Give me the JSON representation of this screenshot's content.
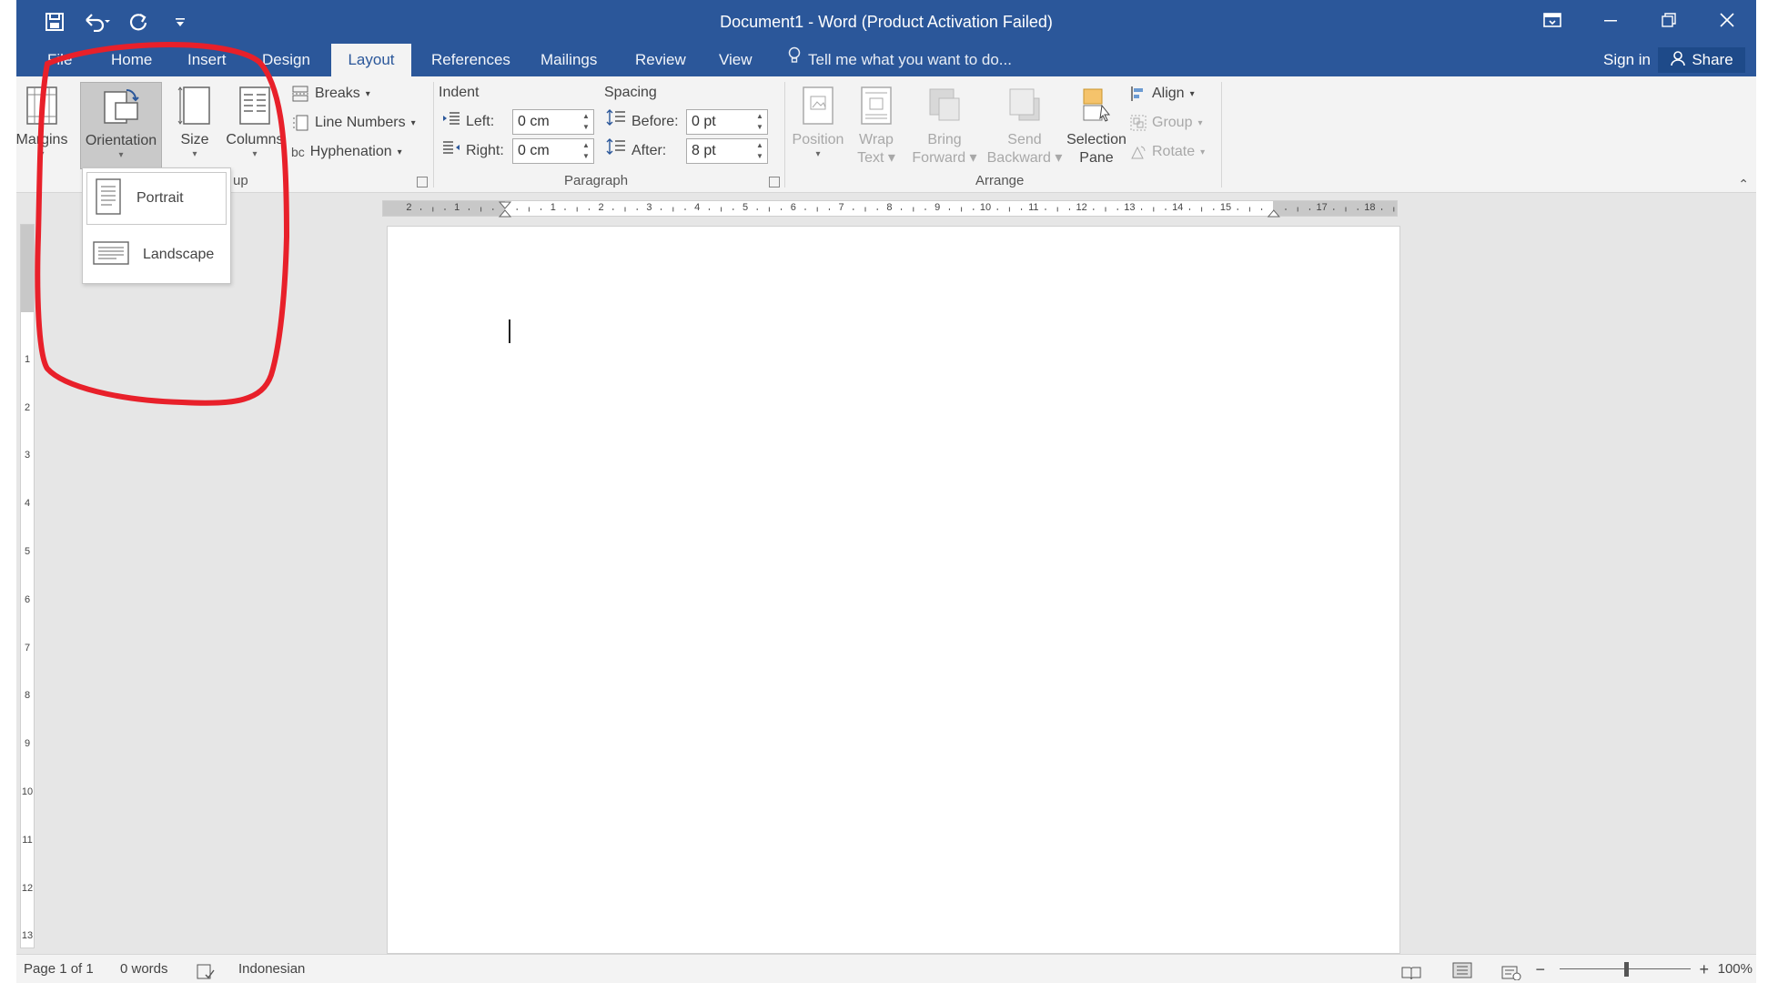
{
  "window": {
    "title": "Document1 - Word (Product Activation Failed)"
  },
  "quick_access": {
    "icons": [
      "save-icon",
      "undo-icon",
      "redo-icon",
      "customize-icon"
    ]
  },
  "tabs": [
    "File",
    "Home",
    "Insert",
    "Design",
    "Layout",
    "References",
    "Mailings",
    "Review",
    "View"
  ],
  "active_tab": "Layout",
  "tell_me": {
    "placeholder": "Tell me what you want to do..."
  },
  "account": {
    "sign_in": "Sign in",
    "share": "Share"
  },
  "page_setup": {
    "margins": "Margins",
    "orientation": "Orientation",
    "size": "Size",
    "columns": "Columns",
    "breaks": "Breaks",
    "line_numbers": "Line Numbers",
    "hyphenation": "Hyphenation",
    "group_label": "up"
  },
  "paragraph": {
    "indent_label": "Indent",
    "spacing_label": "Spacing",
    "left_label": "Left:",
    "right_label": "Right:",
    "before_label": "Before:",
    "after_label": "After:",
    "left_value": "0 cm",
    "right_value": "0 cm",
    "before_value": "0 pt",
    "after_value": "8 pt",
    "group_label": "Paragraph"
  },
  "arrange": {
    "position": "Position",
    "wrap_text_1": "Wrap",
    "wrap_text_2": "Text",
    "bring_forward_1": "Bring",
    "bring_forward_2": "Forward",
    "send_backward_1": "Send",
    "send_backward_2": "Backward",
    "selection_pane_1": "Selection",
    "selection_pane_2": "Pane",
    "align": "Align",
    "group": "Group",
    "rotate": "Rotate",
    "group_label": "Arrange"
  },
  "orientation_menu": {
    "items": [
      "Portrait",
      "Landscape"
    ]
  },
  "ruler": {
    "labels": [
      "2",
      "1",
      "1",
      "2",
      "3",
      "4",
      "5",
      "6",
      "7",
      "8",
      "9",
      "10",
      "11",
      "12",
      "13",
      "14",
      "15",
      "17",
      "18"
    ]
  },
  "vertical_ruler": {
    "labels": [
      "1",
      "2",
      "3",
      "4",
      "5",
      "6",
      "7",
      "8",
      "9",
      "10",
      "11",
      "12",
      "13"
    ]
  },
  "status": {
    "page": "Page 1 of 1",
    "words": "0 words",
    "language": "Indonesian",
    "zoom": "100%"
  },
  "colors": {
    "title_bar": "#2b579a",
    "annotation": "#e8202a"
  }
}
